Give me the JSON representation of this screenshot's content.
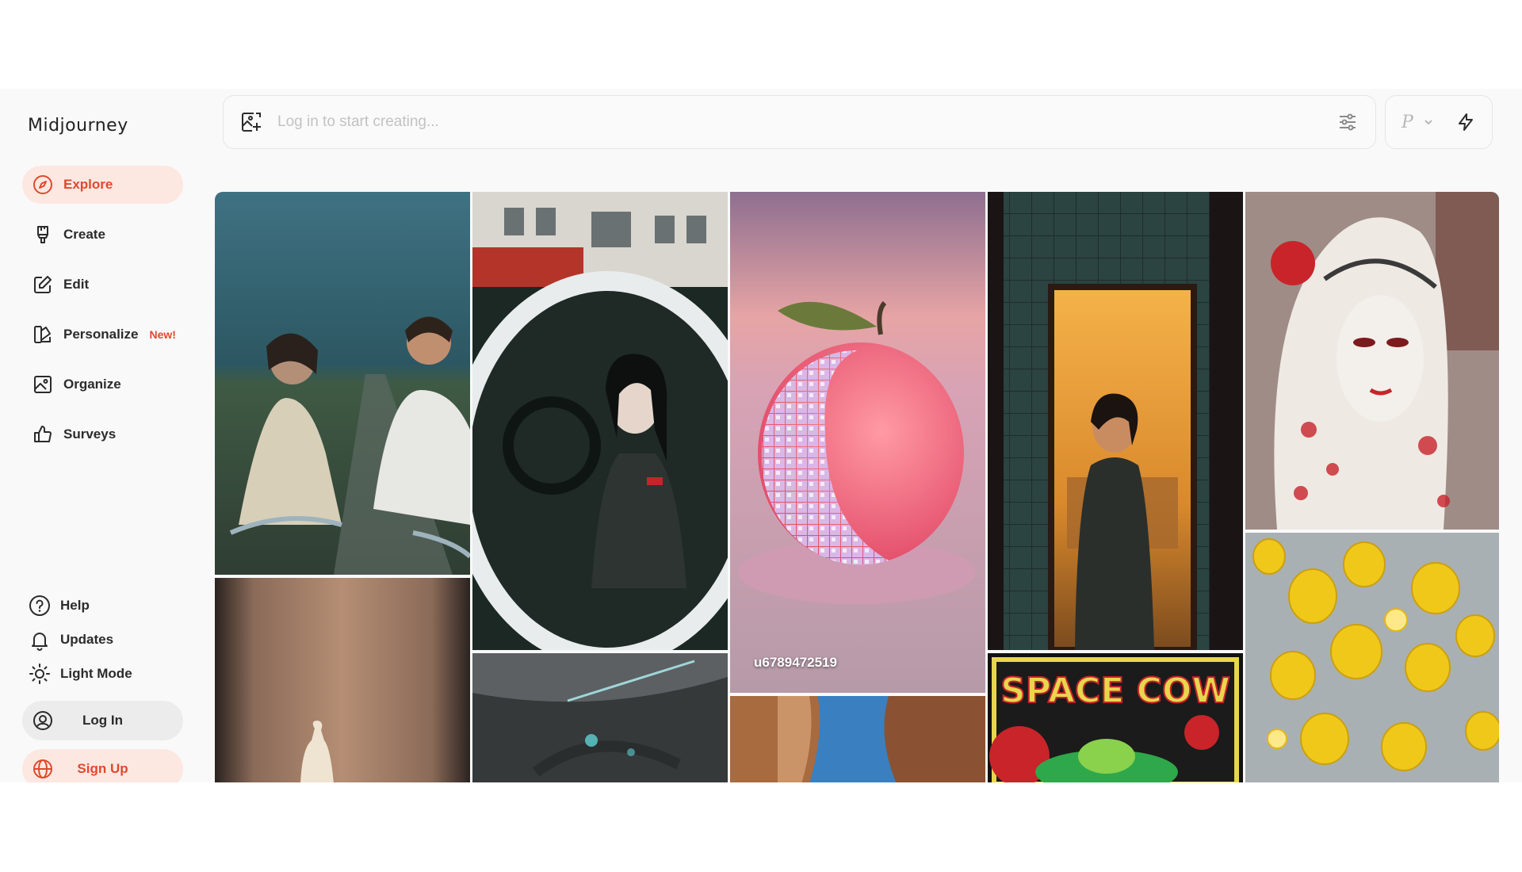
{
  "app": {
    "name": "Midjourney"
  },
  "nav": {
    "items": [
      {
        "label": "Explore",
        "icon": "compass-icon",
        "active": true
      },
      {
        "label": "Create",
        "icon": "brush-icon"
      },
      {
        "label": "Edit",
        "icon": "pencil-square-icon"
      },
      {
        "label": "Personalize",
        "icon": "palette-book-icon",
        "badge": "New!"
      },
      {
        "label": "Organize",
        "icon": "image-frame-icon"
      },
      {
        "label": "Surveys",
        "icon": "thumbs-up-icon"
      }
    ]
  },
  "footer": {
    "help": "Help",
    "updates": "Updates",
    "light_mode": "Light Mode",
    "login": "Log In",
    "signup": "Sign Up"
  },
  "prompt": {
    "placeholder": "Log in to start creating..."
  },
  "settings": {
    "mode_label": "P"
  },
  "gallery": {
    "hover_caption": "u6789472519",
    "tiles": [
      {
        "subject": "couple cycling on a country road"
      },
      {
        "subject": "woman in car, fisheye lens"
      },
      {
        "subject": "disco ball peach"
      },
      {
        "subject": "woman in doorway with warm kitchen"
      },
      {
        "subject": "geisha in red and white mask"
      },
      {
        "subject": "figure on stage"
      },
      {
        "subject": "sci-fi spacecraft interior"
      },
      {
        "subject": "desert canyon"
      },
      {
        "subject": "Space Cow poster",
        "text": "SPACE COW"
      },
      {
        "subject": "falling lemons"
      }
    ]
  },
  "colors": {
    "accent": "#e0492e",
    "accent_bg": "#fde7e1",
    "panel": "#f9f9f9"
  }
}
